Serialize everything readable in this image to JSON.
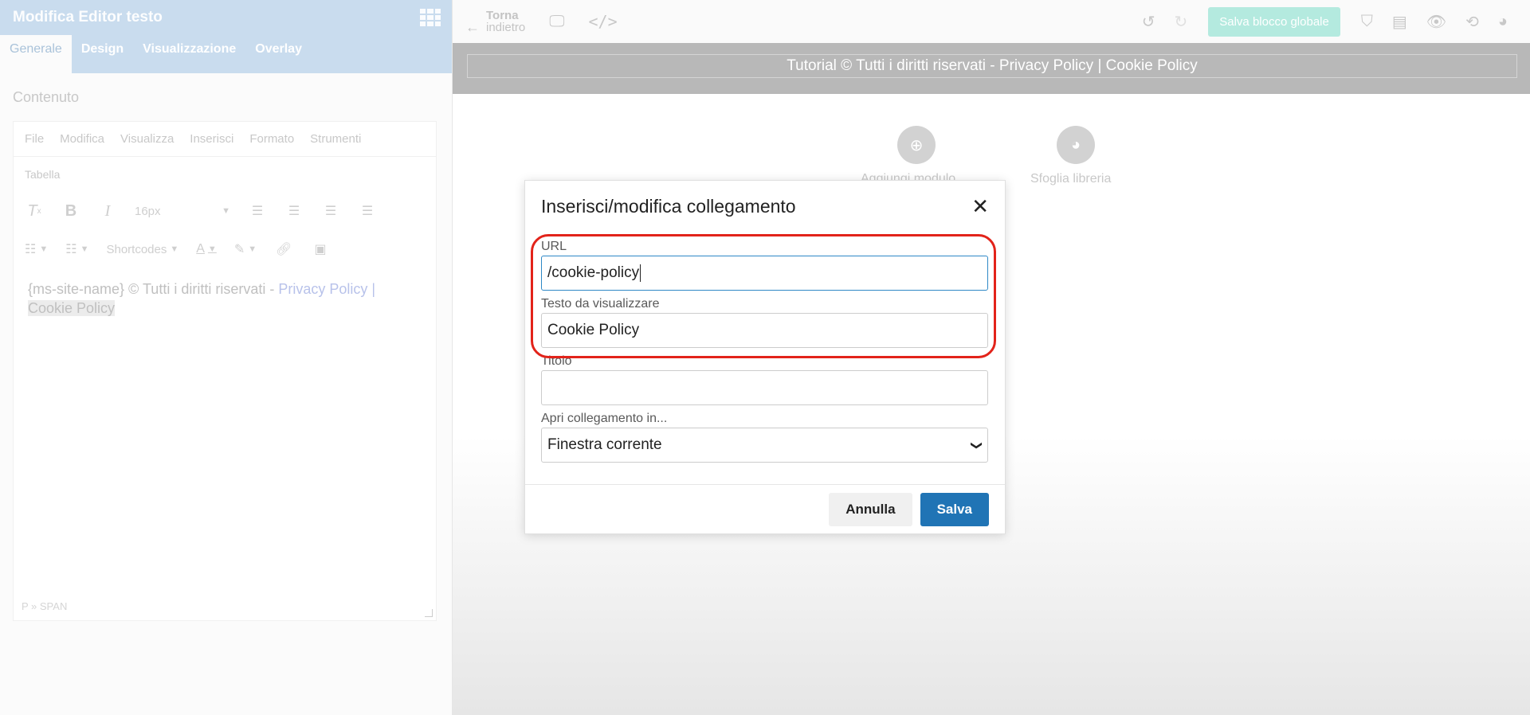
{
  "left_panel": {
    "title": "Modifica Editor testo",
    "tabs": [
      {
        "label": "Generale"
      },
      {
        "label": "Design"
      },
      {
        "label": "Visualizzazione"
      },
      {
        "label": "Overlay"
      }
    ],
    "section_title": "Contenuto",
    "editor": {
      "menu": [
        "File",
        "Modifica",
        "Visualizza",
        "Inserisci",
        "Formato",
        "Strumenti"
      ],
      "table_label": "Tabella",
      "font_size": "16px",
      "shortcodes_label": "Shortcodes",
      "content_prefix": "{ms-site-name} © Tutti i diritti riservati - ",
      "content_link1": "Privacy Policy",
      "content_sep": " |",
      "content_link2": "Cookie Policy",
      "status_path": "P » SPAN"
    }
  },
  "topbar": {
    "back_line1": "Torna",
    "back_line2": "indietro",
    "save_global": "Salva blocco globale"
  },
  "footer_strip": {
    "text": "Tutorial © Tutti i diritti riservati - Privacy Policy | Cookie Policy"
  },
  "canvas": {
    "add_label": "Aggiungi modulo",
    "library_label": "Sfoglia libreria"
  },
  "modal": {
    "title": "Inserisci/modifica collegamento",
    "url_label": "URL",
    "url_value": "/cookie-policy",
    "text_label": "Testo da visualizzare",
    "text_value": "Cookie Policy",
    "title_label": "Titolo",
    "title_value": "",
    "open_label": "Apri collegamento in...",
    "open_value": "Finestra corrente",
    "cancel": "Annulla",
    "save": "Salva"
  },
  "colors": {
    "accent": "#2074b5",
    "highlight": "#e2231a",
    "panel_header": "#c9dcee"
  }
}
